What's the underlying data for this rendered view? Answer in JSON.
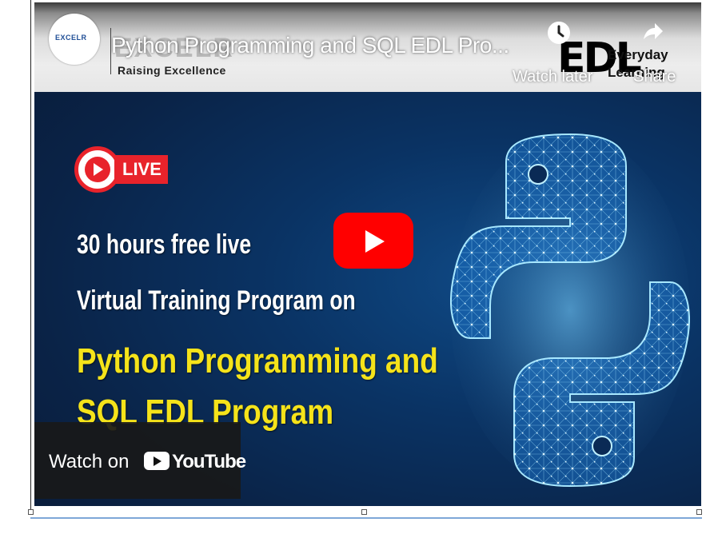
{
  "player": {
    "title": "Python Programming and SQL EDL Pro...",
    "watch_later": "Watch later",
    "share": "Share",
    "watch_on": "Watch on",
    "youtube": "YouTube"
  },
  "channel": {
    "logo_text": "EXCELR",
    "brand": "EXCELR",
    "tagline": "Raising Excellence",
    "edl_mark": "EDL",
    "edl_line1": "Everyday",
    "edl_line2": "Learning"
  },
  "thumbnail": {
    "live": "LIVE",
    "line1": "30 hours free live",
    "line2": "Virtual Training Program on",
    "line3": "Python Programming and",
    "line4": "SQL EDL Program"
  },
  "colors": {
    "live_red": "#e8232b",
    "youtube_red": "#ff0000",
    "headline_yellow": "#f5e31a",
    "background_blue": "#0a2347"
  },
  "icons": [
    "clock-icon",
    "share-icon",
    "play-icon",
    "youtube-logo-icon",
    "python-logo-icon",
    "live-play-icon"
  ]
}
